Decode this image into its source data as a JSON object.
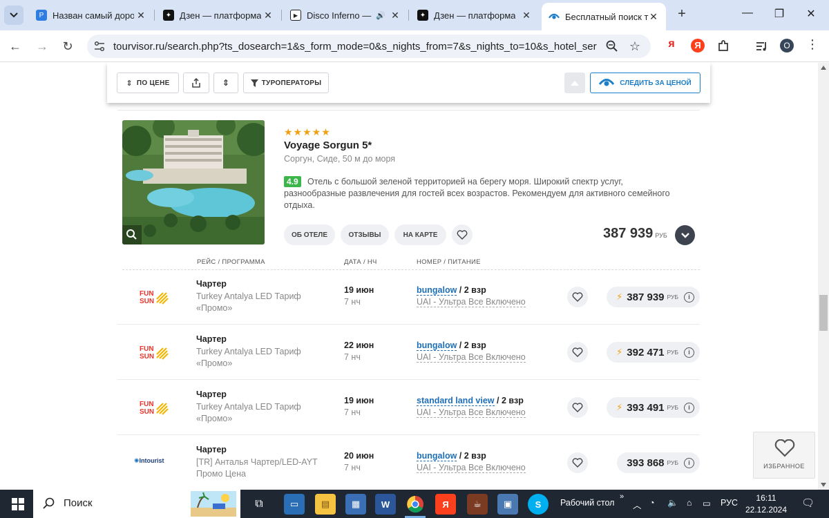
{
  "browser": {
    "tabs": [
      {
        "title": "Назван самый доро",
        "favicon": "P",
        "favicon_color": "#2f7de1"
      },
      {
        "title": "Дзен — платформа",
        "favicon": "✦",
        "favicon_color": "#111111"
      },
      {
        "title": "Disco Inferno —",
        "favicon": "▶",
        "favicon_color": "#222222",
        "audio": "🔊"
      },
      {
        "title": "Дзен — платформа",
        "favicon": "✦",
        "favicon_color": "#111111"
      },
      {
        "title": "Бесплатный поиск т",
        "favicon": "eye",
        "favicon_color": "#1e7fc8",
        "active": true
      }
    ],
    "new_tab": "+",
    "window_controls": {
      "minimize": "—",
      "maximize": "❐",
      "close": "✕"
    },
    "url": "tourvisor.ru/search.php?ts_dosearch=1&s_form_mode=0&s_nights_from=7&s_nights_to=10&s_hotel_servi...",
    "toolbar_icons": [
      "back-icon",
      "forward-icon",
      "reload-icon",
      "site-info-icon",
      "zoom-icon",
      "bookmark-star-icon",
      "yandex-icon",
      "yandex-circle-icon",
      "extensions-icon",
      "media-icon",
      "profile-icon"
    ],
    "yandex_label": "я",
    "yandex_circle_label": "Я",
    "profile_initial": "O"
  },
  "filters": {
    "sort_price": "ПО ЦЕНЕ",
    "operators": "ТУРОПЕРАТОРЫ",
    "watch_price": "СЛЕДИТЬ ЗА ЦЕНОЙ"
  },
  "hotel": {
    "stars": "★★★★★",
    "name": "Voyage Sorgun 5*",
    "location": "Соргун, Сиде, 50 м до моря",
    "rating": "4.9",
    "description": "Отель с большой зеленой территорией на берегу моря. Широкий спектр услуг, разнообразные развлечения для гостей всех возрастов. Рекомендуем для активного семейного отдыха.",
    "buttons": {
      "about": "ОБ ОТЕЛЕ",
      "reviews": "ОТЗЫВЫ",
      "map": "НА КАРТЕ"
    },
    "price": "387 939",
    "currency": "РУБ"
  },
  "table": {
    "headers": {
      "flight": "РЕЙС / ПРОГРАММА",
      "date": "ДАТА / НЧ",
      "room": "НОМЕР / ПИТАНИЕ"
    },
    "rows": [
      {
        "operator": "funsun",
        "type": "Чартер",
        "program": "Turkey Antalya LED Тариф «Промо»",
        "date": "19 июн",
        "nights": "7 нч",
        "room": "bungalow",
        "pax": " / 2 взр",
        "meal": "UAI - Ультра Все Включено",
        "price": "387 939",
        "currency": "РУБ",
        "hot": true
      },
      {
        "operator": "funsun",
        "type": "Чартер",
        "program": "Turkey Antalya LED Тариф «Промо»",
        "date": "22 июн",
        "nights": "7 нч",
        "room": "bungalow",
        "pax": " / 2 взр",
        "meal": "UAI - Ультра Все Включено",
        "price": "392 471",
        "currency": "РУБ",
        "hot": true
      },
      {
        "operator": "funsun",
        "type": "Чартер",
        "program": "Turkey Antalya LED Тариф «Промо»",
        "date": "19 июн",
        "nights": "7 нч",
        "room": "standard land view",
        "pax": " / 2 взр",
        "meal": "UAI - Ультра Все Включено",
        "price": "393 491",
        "currency": "РУБ",
        "hot": true
      },
      {
        "operator": "intourist",
        "type": "Чартер",
        "program": "[TR] Анталья Чартер/LED-AYT Промо Цена",
        "date": "20 июн",
        "nights": "7 нч",
        "room": "bungalow",
        "pax": " / 2 взр",
        "meal": "UAI - Ультра Все Включено",
        "price": "393 868",
        "currency": "РУБ",
        "hot": false
      }
    ]
  },
  "operators": {
    "funsun_top": "FUN",
    "funsun_bottom": "SUN",
    "intourist": "Intourist"
  },
  "favorites": {
    "label": "ИЗБРАННОЕ"
  },
  "taskbar": {
    "search": "Поиск",
    "desktop": "Рабочий стол",
    "language": "РУС",
    "time": "16:11",
    "date": "22.12.2024"
  },
  "colors": {
    "accent": "#1e7fc8",
    "rating_green": "#3cb54a",
    "star": "#f0a113",
    "room_link": "#1e6fb8"
  }
}
